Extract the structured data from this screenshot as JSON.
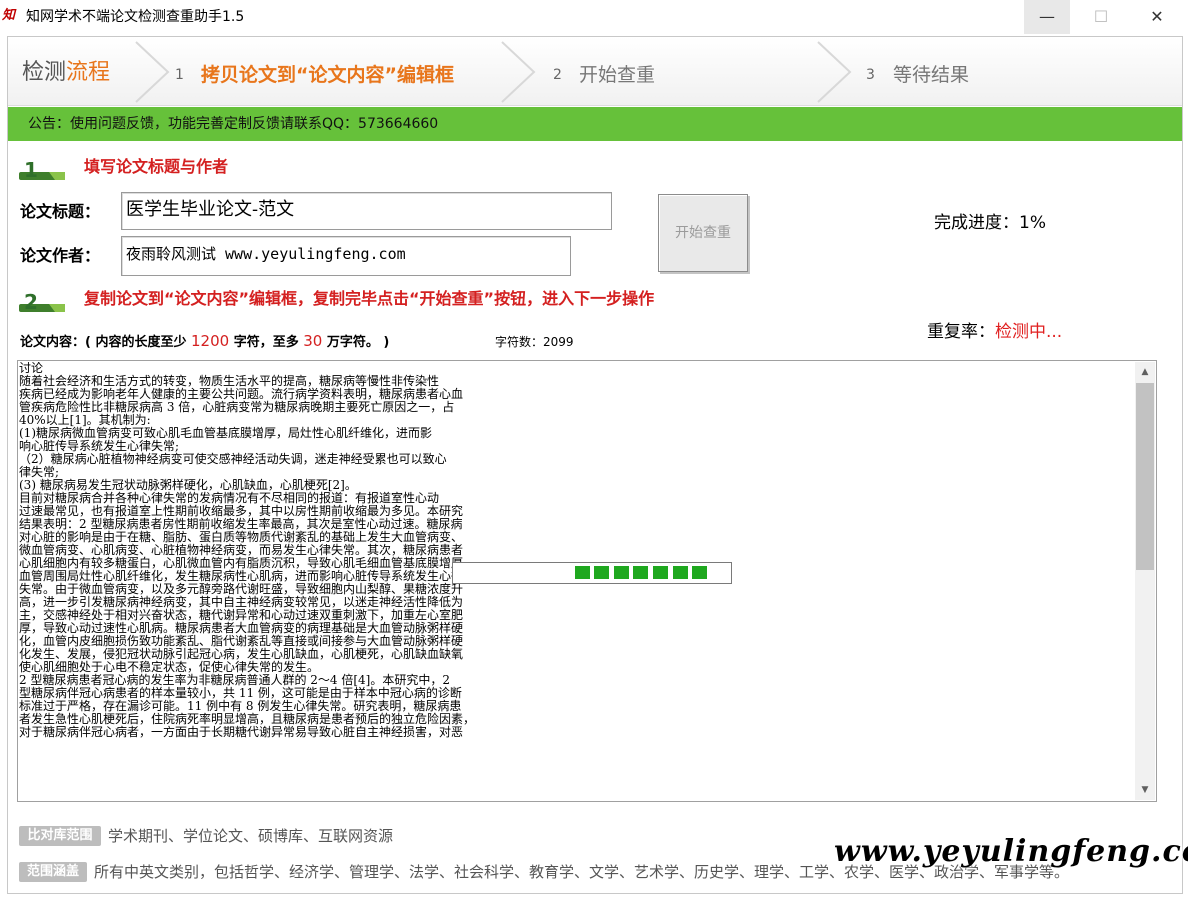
{
  "window": {
    "logo": "知",
    "title": "知网学术不端论文检测查重助手1.5",
    "minimize": "—",
    "maximize": "☐",
    "close": "✕"
  },
  "steps": {
    "flow_title_a": "检测",
    "flow_title_b": "流程",
    "items": [
      {
        "num": "1",
        "label": "拷贝论文到“论文内容”编辑框"
      },
      {
        "num": "2",
        "label": "开始查重"
      },
      {
        "num": "3",
        "label": "等待结果"
      }
    ]
  },
  "notice": "公告：使用问题反馈，功能完善定制反馈请联系QQ：573664660",
  "section1": {
    "badge": "1",
    "title": "填写论文标题与作者"
  },
  "form": {
    "title_label": "论文标题：",
    "title_value": "医学生毕业论文-范文",
    "author_label": "论文作者：",
    "author_value": "夜雨聆风测试 www.yeyulingfeng.com"
  },
  "start_button": "开始查重",
  "progress_text": "完成进度：1%",
  "section2": {
    "badge": "2",
    "title": "复制论文到“论文内容”编辑框，复制完毕点击“开始查重”按钮，进入下一步操作"
  },
  "dup": {
    "label": "重复率：",
    "value": "检测中..."
  },
  "content_label": {
    "prefix": "论文内容：( 内容的长度至少 ",
    "min": "1200",
    "mid": " 字符，至多 ",
    "max": "30",
    "suffix": " 万字符。 )",
    "count": "字符数：2099"
  },
  "content_text": "讨论\n随着社会经济和生活方式的转变，物质生活水平的提高，糖尿病等慢性非传染性\n疾病已经成为影响老年人健康的主要公共问题。流行病学资料表明，糖尿病患者心血\n管疾病危险性比非糖尿病高 3 倍，心脏病变常为糖尿病晚期主要死亡原因之一，占\n40%以上[1]。其机制为:\n(1)糖尿病微血管病变可致心肌毛血管基底膜增厚，局灶性心肌纤维化，进而影\n响心脏传导系统发生心律失常;\n（2）糖尿病心脏植物神经病变可使交感神经活动失调，迷走神经受累也可以致心\n律失常;\n(3) 糖尿病易发生冠状动脉粥样硬化，心肌缺血，心肌梗死[2]。\n目前对糖尿病合并各种心律失常的发病情况有不尽相同的报道：有报道室性心动\n过速最常见，也有报道室上性期前收缩最多，其中以房性期前收缩最为多见。本研究\n结果表明：2 型糖尿病患者房性期前收缩发生率最高，其次是室性心动过速。糖尿病\n对心脏的影响是由于在糖、脂肪、蛋白质等物质代谢紊乱的基础上发生大血管病变、\n微血管病变、心肌病变、心脏植物神经病变，而易发生心律失常。其次，糖尿病患者\n心肌细胞内有较多糖蛋白，心肌微血管内有脂质沉积，导致心肌毛细血管基底膜增厚，\n血管周围局灶性心肌纤维化，发生糖尿病性心肌病，进而影响心脏传导系统发生心律\n失常。由于微血管病变，以及多元醇旁路代谢旺盛，导致细胞内山梨醇、果糖浓度升\n高，进一步引发糖尿病神经病变，其中自主神经病变较常见，以迷走神经活性降低为\n主，交感神经处于相对兴奋状态，糖代谢异常和心动过速双重刺激下，加重左心室肥\n厚，导致心动过速性心肌病。糖尿病患者大血管病变的病理基础是大血管动脉粥样硬\n化，血管内皮细胞损伤致功能紊乱、脂代谢紊乱等直接或间接参与大血管动脉粥样硬\n化发生、发展，侵犯冠状动脉引起冠心病，发生心肌缺血，心肌梗死，心肌缺血缺氧\n使心肌细胞处于心电不稳定状态，促使心律失常的发生。\n2 型糖尿病患者冠心病的发生率为非糖尿病普通人群的 2～4 倍[4]。本研究中，2\n型糖尿病伴冠心病患者的样本量较小，共 11 例，这可能是由于样本中冠心病的诊断\n标准过于严格，存在漏诊可能。11 例中有 8 例发生心律失常。研究表明，糖尿病患\n者发生急性心肌梗死后，住院病死率明显增高，且糖尿病是患者预后的独立危险因素，\n对于糖尿病伴冠心病者，一方面由于长期糖代谢异常易导致心脏自主神经损害，对恶",
  "scroll": {
    "up": "▲",
    "down": "▼"
  },
  "busy_progress": 0.55,
  "footer": {
    "tag1": "比对库范围",
    "text1": "学术期刊、学位论文、硕博库、互联网资源",
    "tag2": "范围涵盖",
    "text2": "所有中英文类别，包括哲学、经济学、管理学、法学、社会科学、教育学、文学、艺术学、历史学、理学、工学、农学、医学、政治学、军事学等。"
  },
  "watermark": "www.yeyulingfeng.com",
  "colors": {
    "notice_bg": "#66c13a",
    "accent": "#e8761c",
    "alert_red": "#d42020",
    "busy_green": "#1fa81f"
  }
}
